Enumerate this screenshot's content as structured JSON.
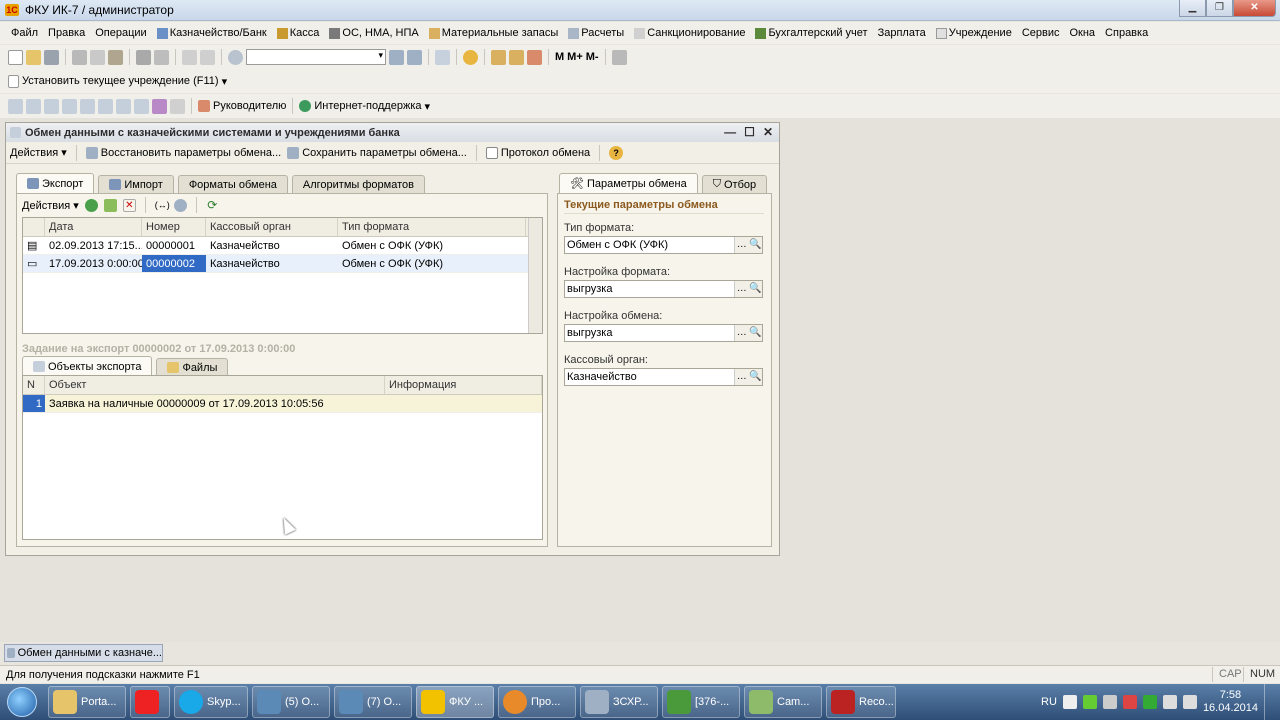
{
  "window": {
    "title": "ФКУ ИК-7 / администратор"
  },
  "menu": [
    "Файл",
    "Правка",
    "Операции",
    "Казначейство/Банк",
    "Касса",
    "ОС, НМА, НПА",
    "Материальные запасы",
    "Расчеты",
    "Санкционирование",
    "Бухгалтерский учет",
    "Зарплата",
    "Учреждение",
    "Сервис",
    "Окна",
    "Справка"
  ],
  "toolbar2": {
    "set_institution": "Установить текущее учреждение (F11)"
  },
  "toolbar3": {
    "manager": "Руководителю",
    "support": "Интернет-поддержка"
  },
  "form": {
    "title": "Обмен данными с казначейскими системами и учреждениями банка",
    "toolbar": {
      "actions": "Действия",
      "restore": "Восстановить параметры обмена...",
      "save": "Сохранить параметры обмена...",
      "protocol": "Протокол обмена"
    },
    "tabs": [
      "Экспорт",
      "Импорт",
      "Форматы обмена",
      "Алгоритмы форматов"
    ],
    "grid_actions": "Действия",
    "grid": {
      "columns": [
        "Дата",
        "Номер",
        "Кассовый орган",
        "Тип формата"
      ],
      "rows": [
        [
          "02.09.2013 17:15...",
          "00000001",
          "Казначейство",
          "Обмен с ОФК (УФК)"
        ],
        [
          "17.09.2013 0:00:00",
          "00000002",
          "Казначейство",
          "Обмен с ОФК (УФК)"
        ]
      ]
    },
    "task_caption": "Задание на экспорт 00000002 от 17.09.2013 0:00:00",
    "subtabs": [
      "Объекты экспорта",
      "Файлы"
    ],
    "objects": {
      "columns": [
        "N",
        "Объект",
        "Информация"
      ],
      "rows": [
        [
          "1",
          "Заявка на наличные 00000009 от 17.09.2013 10:05:56",
          ""
        ]
      ]
    },
    "right_tabs": [
      "Параметры обмена",
      "Отбор"
    ],
    "params_title": "Текущие параметры обмена",
    "params": [
      {
        "label": "Тип формата:",
        "value": "Обмен с ОФК (УФК)"
      },
      {
        "label": "Настройка формата:",
        "value": "выгрузка"
      },
      {
        "label": "Настройка обмена:",
        "value": "выгрузка"
      },
      {
        "label": "Кассовый орган:",
        "value": "Казначейство"
      }
    ]
  },
  "window_tab": "Обмен данными с казначе...",
  "status": {
    "hint": "Для получения подсказки нажмите F1",
    "cap": "CAP",
    "num": "NUM"
  },
  "taskbar": {
    "buttons": [
      "Porta...",
      "",
      "Skyp...",
      "(5) О...",
      "(7) О...",
      "ФКУ ...",
      "Про...",
      "ЗСХР...",
      "[376-...",
      "Cam...",
      "Reco..."
    ],
    "lang": "RU",
    "time": "7:58",
    "date": "16.04.2014"
  }
}
